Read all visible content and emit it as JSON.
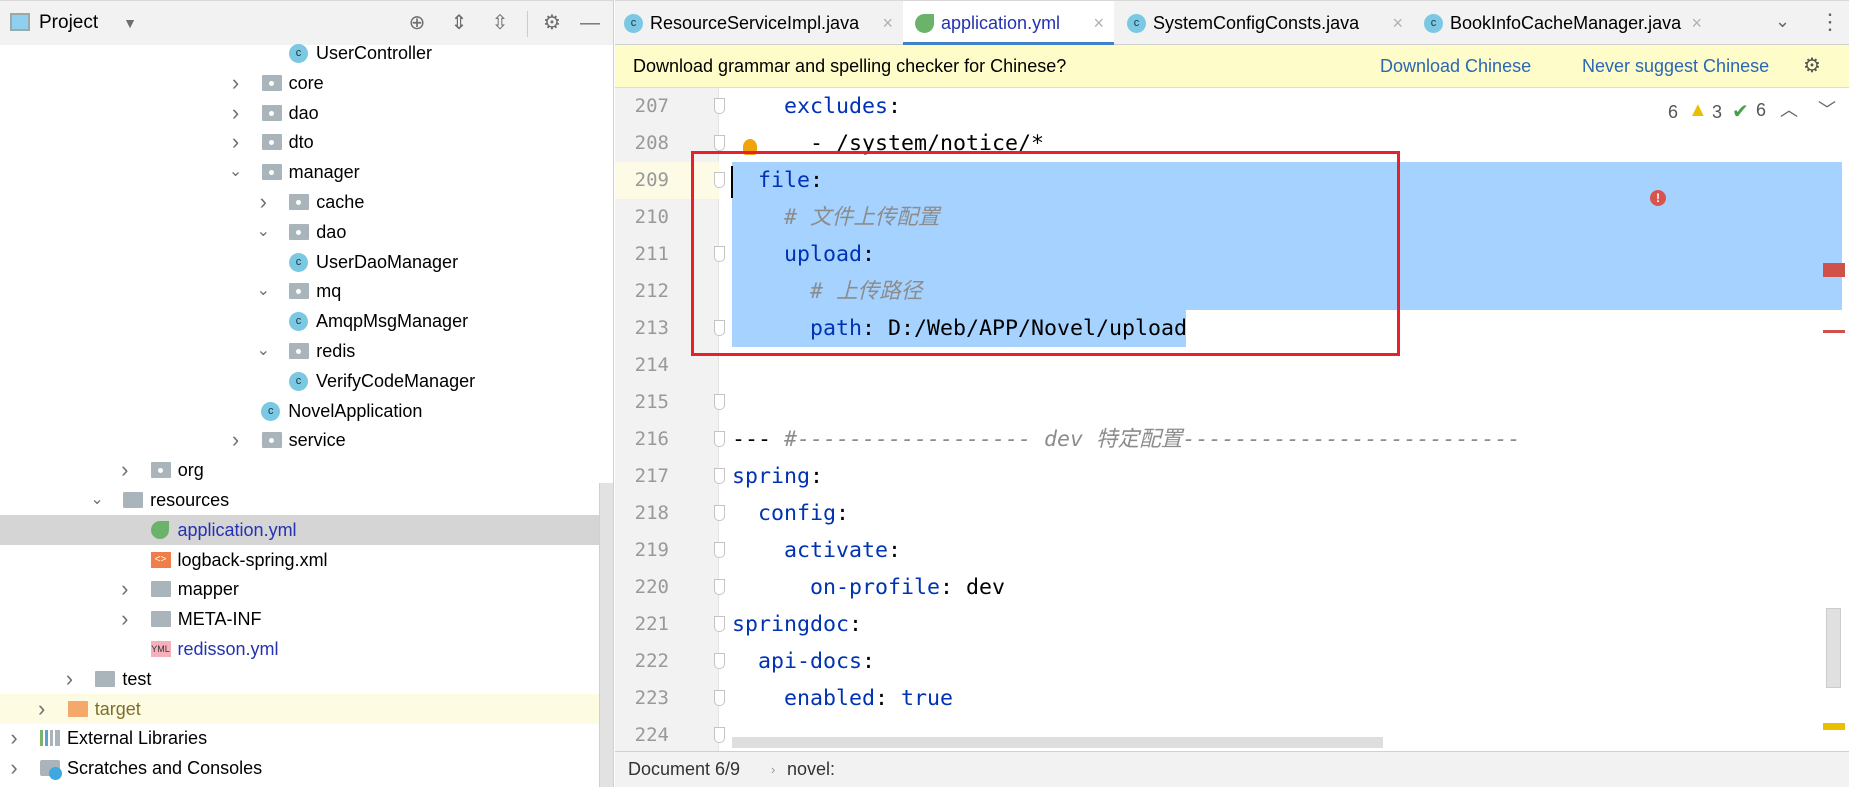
{
  "sidebar": {
    "title": "Project",
    "tree": [
      {
        "label": "UserController",
        "level": 10,
        "kind": "class",
        "chevron": ""
      },
      {
        "label": "core",
        "level": 8,
        "kind": "package",
        "chevron": "right"
      },
      {
        "label": "dao",
        "level": 8,
        "kind": "package",
        "chevron": "right"
      },
      {
        "label": "dto",
        "level": 8,
        "kind": "package",
        "chevron": "right"
      },
      {
        "label": "manager",
        "level": 8,
        "kind": "package",
        "chevron": "down"
      },
      {
        "label": "cache",
        "level": 9,
        "kind": "package",
        "chevron": "right"
      },
      {
        "label": "dao",
        "level": 9,
        "kind": "package",
        "chevron": "down"
      },
      {
        "label": "UserDaoManager",
        "level": 10,
        "kind": "class",
        "chevron": ""
      },
      {
        "label": "mq",
        "level": 9,
        "kind": "package",
        "chevron": "down"
      },
      {
        "label": "AmqpMsgManager",
        "level": 10,
        "kind": "class",
        "chevron": ""
      },
      {
        "label": "redis",
        "level": 9,
        "kind": "package",
        "chevron": "down"
      },
      {
        "label": "VerifyCodeManager",
        "level": 10,
        "kind": "class",
        "chevron": ""
      },
      {
        "label": "NovelApplication",
        "level": 9,
        "kind": "class",
        "chevron": ""
      },
      {
        "label": "service",
        "level": 8,
        "kind": "package",
        "chevron": "right"
      },
      {
        "label": "org",
        "level": 4,
        "kind": "package",
        "chevron": "right"
      },
      {
        "label": "resources",
        "level": 3,
        "kind": "folder",
        "chevron": "down"
      },
      {
        "label": "application.yml",
        "level": 5,
        "kind": "spring-yml",
        "chevron": "",
        "color": "#2332b0",
        "selected": true
      },
      {
        "label": "logback-spring.xml",
        "level": 5,
        "kind": "xml",
        "chevron": ""
      },
      {
        "label": "mapper",
        "level": 4,
        "kind": "folder",
        "chevron": "right"
      },
      {
        "label": "META-INF",
        "level": 4,
        "kind": "folder",
        "chevron": "right"
      },
      {
        "label": "redisson.yml",
        "level": 5,
        "kind": "yml",
        "chevron": "",
        "color": "#2332b0"
      },
      {
        "label": "test",
        "level": 2,
        "kind": "folder",
        "chevron": "right"
      },
      {
        "label": "target",
        "level": 1,
        "kind": "folder-excluded",
        "chevron": "right",
        "color": "#7d6f2a",
        "excluded": true
      },
      {
        "label": "External Libraries",
        "level": 0,
        "kind": "libraries",
        "chevron": "right"
      },
      {
        "label": "Scratches and Consoles",
        "level": 0,
        "kind": "scratches",
        "chevron": "right"
      }
    ]
  },
  "tabs": [
    {
      "label": "ResourceServiceImpl.java",
      "icon": "class"
    },
    {
      "label": "application.yml",
      "icon": "spring",
      "active": true
    },
    {
      "label": "SystemConfigConsts.java",
      "icon": "class"
    },
    {
      "label": "BookInfoCacheManager.java",
      "icon": "class"
    }
  ],
  "notification": {
    "message": "Download grammar and spelling checker for Chinese?",
    "download": "Download Chinese",
    "never": "Never suggest Chinese"
  },
  "inspections": {
    "errors": "6",
    "warnings": "3",
    "weak": "6"
  },
  "editor": {
    "selection_color": "#a6d2ff",
    "lines": [
      {
        "n": "207",
        "tokens": [
          {
            "t": "    excludes",
            "c": "k"
          },
          {
            "t": ":",
            "c": "p"
          }
        ]
      },
      {
        "n": "208",
        "tokens": [
          {
            "t": "      - /system/notice/*",
            "c": "p"
          }
        ]
      },
      {
        "n": "209",
        "tokens": [
          {
            "t": "  file",
            "c": "k"
          },
          {
            "t": ":",
            "c": "p"
          }
        ],
        "selected": "full",
        "current": true
      },
      {
        "n": "210",
        "tokens": [
          {
            "t": "    # 文件上传配置",
            "c": "c"
          }
        ],
        "selected": "full"
      },
      {
        "n": "211",
        "tokens": [
          {
            "t": "    upload",
            "c": "k"
          },
          {
            "t": ":",
            "c": "p"
          }
        ],
        "selected": "full"
      },
      {
        "n": "212",
        "tokens": [
          {
            "t": "      # 上传路径",
            "c": "c"
          }
        ],
        "selected": "full"
      },
      {
        "n": "213",
        "tokens": [
          {
            "t": "      path",
            "c": "k"
          },
          {
            "t": ": D:/Web/APP/Novel/upload",
            "c": "p"
          }
        ],
        "selected": "text"
      },
      {
        "n": "214",
        "tokens": []
      },
      {
        "n": "215",
        "tokens": []
      },
      {
        "n": "216",
        "tokens": [
          {
            "t": "--- ",
            "c": "p"
          },
          {
            "t": "#------------------ dev 特定配置--------------------------",
            "c": "c"
          }
        ]
      },
      {
        "n": "217",
        "tokens": [
          {
            "t": "spring",
            "c": "k"
          },
          {
            "t": ":",
            "c": "p"
          }
        ]
      },
      {
        "n": "218",
        "tokens": [
          {
            "t": "  config",
            "c": "k"
          },
          {
            "t": ":",
            "c": "p"
          }
        ]
      },
      {
        "n": "219",
        "tokens": [
          {
            "t": "    activate",
            "c": "k"
          },
          {
            "t": ":",
            "c": "p"
          }
        ]
      },
      {
        "n": "220",
        "tokens": [
          {
            "t": "      on-profile",
            "c": "k"
          },
          {
            "t": ": dev",
            "c": "p"
          }
        ]
      },
      {
        "n": "221",
        "tokens": [
          {
            "t": "springdoc",
            "c": "k"
          },
          {
            "t": ":",
            "c": "p"
          }
        ]
      },
      {
        "n": "222",
        "tokens": [
          {
            "t": "  api-docs",
            "c": "k"
          },
          {
            "t": ":",
            "c": "p"
          }
        ]
      },
      {
        "n": "223",
        "tokens": [
          {
            "t": "    enabled",
            "c": "k"
          },
          {
            "t": ": ",
            "c": "p"
          },
          {
            "t": "true",
            "c": "b"
          }
        ]
      },
      {
        "n": "224",
        "tokens": []
      }
    ]
  },
  "status": {
    "document": "Document 6/9",
    "path": "novel:"
  },
  "colors": {
    "highlight_box": "#e8202a",
    "link": "#2a67b5",
    "key": "#0033b3",
    "comment": "#8c8c8c"
  }
}
